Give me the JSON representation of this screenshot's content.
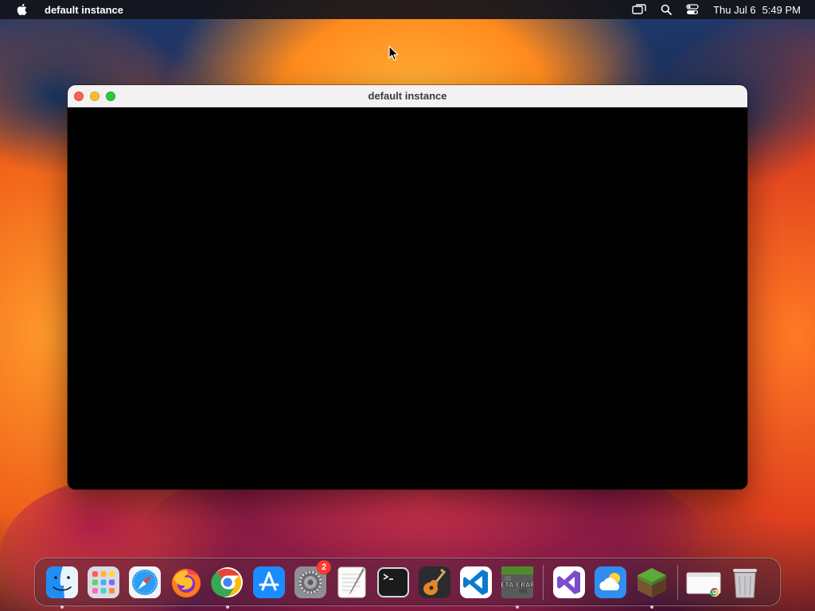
{
  "menubar": {
    "app_name": "default instance",
    "date": "Thu Jul 6",
    "time": "5:49 PM",
    "icons": [
      "apple-icon",
      "screen-mirroring-icon",
      "spotlight-search-icon",
      "control-center-icon"
    ]
  },
  "window": {
    "title": "default instance"
  },
  "dock": {
    "items": [
      {
        "name": "Finder",
        "icon": "finder-icon",
        "running": true
      },
      {
        "name": "Launchpad",
        "icon": "launchpad-icon",
        "running": false
      },
      {
        "name": "Safari",
        "icon": "safari-icon",
        "running": false
      },
      {
        "name": "Firefox",
        "icon": "firefox-icon",
        "running": false
      },
      {
        "name": "Google Chrome",
        "icon": "chrome-icon",
        "running": true
      },
      {
        "name": "App Store",
        "icon": "app-store-icon",
        "running": false
      },
      {
        "name": "System Settings",
        "icon": "system-settings-icon",
        "running": false,
        "badge": "2"
      },
      {
        "name": "TextEdit",
        "icon": "textedit-icon",
        "running": false
      },
      {
        "name": "Terminal",
        "icon": "terminal-icon",
        "running": false
      },
      {
        "name": "GarageBand",
        "icon": "garageband-icon",
        "running": false
      },
      {
        "name": "Visual Studio Code",
        "icon": "vscode-icon",
        "running": false
      },
      {
        "name": "Beta Craft",
        "icon": "betacraft-icon",
        "running": true,
        "label": "BETA CRAFT"
      },
      {
        "name": "Visual Studio",
        "icon": "visual-studio-icon",
        "running": false
      },
      {
        "name": "Weather",
        "icon": "weather-icon",
        "running": false
      },
      {
        "name": "Minecraft",
        "icon": "minecraft-icon",
        "running": true
      },
      {
        "name": "Chrome Window",
        "icon": "chrome-window-icon",
        "running": false
      },
      {
        "name": "Trash",
        "icon": "trash-icon",
        "running": false
      }
    ]
  },
  "colors": {
    "menubar_bg": "#14141a",
    "window_titlebar": "#f3f1f2",
    "window_content": "#000000",
    "close": "#ff5f57",
    "minimize": "#febc2e",
    "maximize": "#28c840",
    "badge": "#ff3b30"
  }
}
